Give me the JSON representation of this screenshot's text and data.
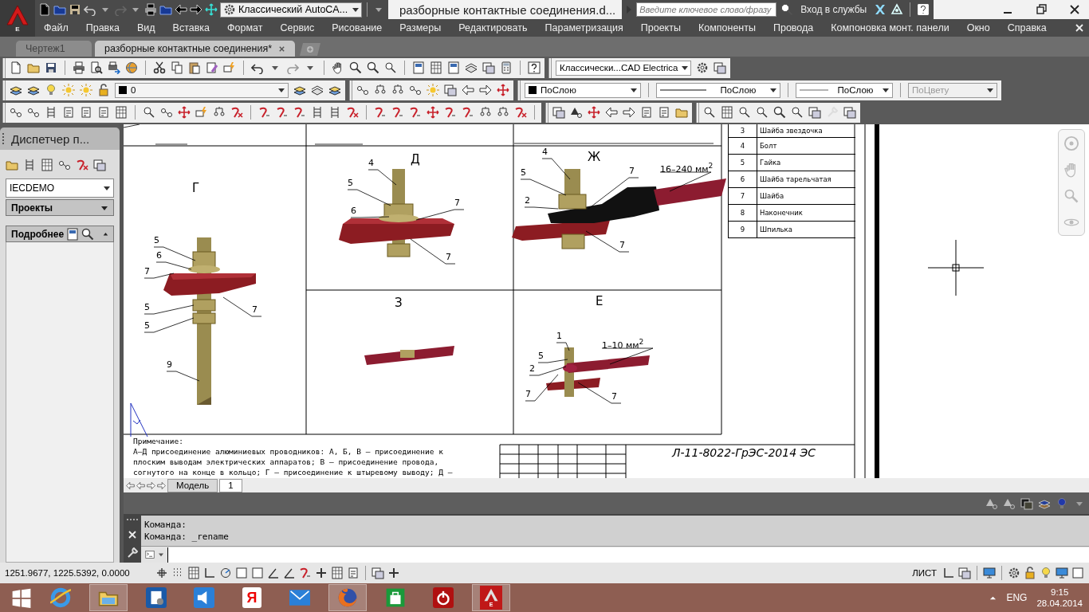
{
  "title_bar": {
    "app_badge": "E",
    "workspace": "Классический AutoCA...",
    "document_title": "разборные контактные соединения.d...",
    "search": {
      "placeholder": "Введите ключевое слово/фразу"
    },
    "sign_in": "Вход в службы"
  },
  "menu_bar": [
    "Файл",
    "Правка",
    "Вид",
    "Вставка",
    "Формат",
    "Сервис",
    "Рисование",
    "Размеры",
    "Редактировать",
    "Параметризация",
    "Проекты",
    "Компоненты",
    "Провода",
    "Компоновка монт. панели",
    "Окно",
    "Справка"
  ],
  "document_tabs": [
    {
      "label": "Чертеж1",
      "selected": false
    },
    {
      "label": "разборные контактные соединения*",
      "selected": true
    }
  ],
  "toolbars": {
    "workspace": "Классически...CAD Electrica",
    "layer": "0",
    "color_control": "ПоСлою",
    "linetype": "ПоСлою",
    "lineweight": "ПоСлою",
    "plot_style": {
      "value": "ПоЦвету",
      "disabled": true
    }
  },
  "project_manager": {
    "title": "Диспетчер п...",
    "project": "IECDEMO",
    "sections": [
      {
        "label": "Проекты",
        "expanded": false
      },
      {
        "label": "Подробнее",
        "expanded": true
      }
    ]
  },
  "drawing": {
    "views": [
      {
        "letter": "Г",
        "callouts": [
          "5",
          "6",
          "7",
          "5",
          "5",
          "7",
          "9"
        ]
      },
      {
        "letter": "Д",
        "callouts": [
          "4",
          "5",
          "6",
          "7",
          "7"
        ]
      },
      {
        "letter": "Ж",
        "callouts": [
          "4",
          "5",
          "2",
          "7",
          "7",
          "16–240 мм$^{2}$"
        ]
      },
      {
        "letter": "З"
      },
      {
        "letter": "Е",
        "callouts": [
          "1",
          "5",
          "2",
          "7",
          "7",
          "1–10 мм$^{2}$"
        ]
      }
    ],
    "parts": [
      {
        "number": "3",
        "name": "Шайба звездочка"
      },
      {
        "number": "4",
        "name": "Болт"
      },
      {
        "number": "5",
        "name": "Гайка"
      },
      {
        "number": "6",
        "name": "Шайба тарельчатая"
      },
      {
        "number": "7",
        "name": "Шайба"
      },
      {
        "number": "8",
        "name": "Наконечник"
      },
      {
        "number": "9",
        "name": "Шпилька"
      }
    ],
    "note": [
      "Примечание:",
      "А–Д присоединение алюминиевых проводников: А, Б, В – присоединение к",
      "плоским выводам электрических аппаратов; В – присоединение провода,",
      "согнутого на конце в кольцо; Г – присоединение к штыревому выводу; Д –"
    ],
    "stamp": "Л-11-8022-ГрЭС-2014 ЭС"
  },
  "layout_tabs": [
    {
      "label": "Модель",
      "selected": false
    },
    {
      "label": "1",
      "selected": true
    }
  ],
  "command_history": [
    "Команда:",
    "Команда:  _rename"
  ],
  "status_bar": {
    "coordinates": "1251.9677, 1225.5392, 0.0000",
    "space": "ЛИСТ"
  },
  "taskbar": {
    "yandex_letter": "Я",
    "autocad_badge": "E",
    "language": "ENG",
    "time": "9:15",
    "date": "28.04.2014"
  }
}
